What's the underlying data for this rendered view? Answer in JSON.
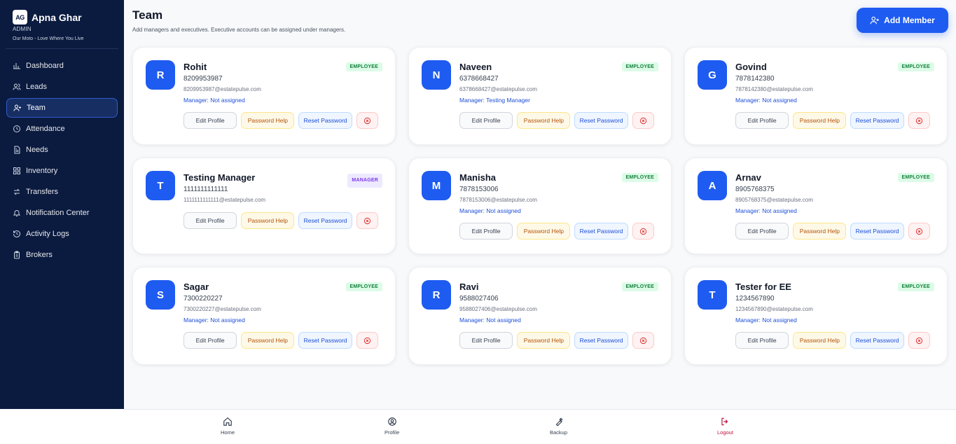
{
  "brand": {
    "logo_text": "AG",
    "name": "Apna Ghar",
    "role": "ADMIN",
    "motto": "Our Moto - Love Where You Live"
  },
  "sidebar": {
    "items": [
      {
        "label": "Dashboard",
        "icon": "chart-icon"
      },
      {
        "label": "Leads",
        "icon": "users-icon"
      },
      {
        "label": "Team",
        "icon": "user-plus-icon"
      },
      {
        "label": "Attendance",
        "icon": "clock-icon"
      },
      {
        "label": "Needs",
        "icon": "document-icon"
      },
      {
        "label": "Inventory",
        "icon": "grid-icon"
      },
      {
        "label": "Transfers",
        "icon": "transfer-icon"
      },
      {
        "label": "Notification Center",
        "icon": "bell-icon"
      },
      {
        "label": "Activity Logs",
        "icon": "history-icon"
      },
      {
        "label": "Brokers",
        "icon": "clipboard-icon"
      }
    ],
    "active": "Team"
  },
  "header": {
    "title": "Team",
    "subtitle": "Add managers and executives. Executive accounts can be assigned under managers.",
    "add_button": "Add Member"
  },
  "actions": {
    "edit": "Edit Profile",
    "help": "Password Help",
    "reset": "Reset Password"
  },
  "members": [
    {
      "initial": "R",
      "name": "Rohit",
      "phone": "8209953987",
      "email": "8209953987@estatepulse.com",
      "manager": "Manager: Not assigned",
      "role": "EMPLOYEE"
    },
    {
      "initial": "N",
      "name": "Naveen",
      "phone": "6378668427",
      "email": "6378668427@estatepulse.com",
      "manager": "Manager: Testing Manager",
      "role": "EMPLOYEE"
    },
    {
      "initial": "G",
      "name": "Govind",
      "phone": "7878142380",
      "email": "7878142380@estatepulse.com",
      "manager": "Manager: Not assigned",
      "role": "EMPLOYEE"
    },
    {
      "initial": "T",
      "name": "Testing Manager",
      "phone": "1111111111111",
      "email": "1111111111111@estatepulse.com",
      "manager": "",
      "role": "MANAGER"
    },
    {
      "initial": "M",
      "name": "Manisha",
      "phone": "7878153006",
      "email": "7878153006@estatepulse.com",
      "manager": "Manager: Not assigned",
      "role": "EMPLOYEE"
    },
    {
      "initial": "A",
      "name": "Arnav",
      "phone": "8905768375",
      "email": "8905768375@estatepulse.com",
      "manager": "Manager: Not assigned",
      "role": "EMPLOYEE"
    },
    {
      "initial": "S",
      "name": "Sagar",
      "phone": "7300220227",
      "email": "7300220227@estatepulse.com",
      "manager": "Manager: Not assigned",
      "role": "EMPLOYEE"
    },
    {
      "initial": "R",
      "name": "Ravi",
      "phone": "9588027406",
      "email": "9588027406@estatepulse.com",
      "manager": "Manager: Not assigned",
      "role": "EMPLOYEE"
    },
    {
      "initial": "T",
      "name": "Tester for EE",
      "phone": "1234567890",
      "email": "1234567890@estatepulse.com",
      "manager": "Manager: Not assigned",
      "role": "EMPLOYEE"
    }
  ],
  "bottom_nav": [
    {
      "label": "Home",
      "icon": "home-icon"
    },
    {
      "label": "Profile",
      "icon": "profile-icon"
    },
    {
      "label": "Backup",
      "icon": "wrench-icon"
    },
    {
      "label": "Logout",
      "icon": "logout-icon"
    }
  ],
  "colors": {
    "sidebar_bg": "#0b1a3f",
    "accent": "#1e5bf0",
    "employee_badge": "#15803d",
    "manager_badge": "#7c3aed",
    "logout": "#be123c"
  }
}
